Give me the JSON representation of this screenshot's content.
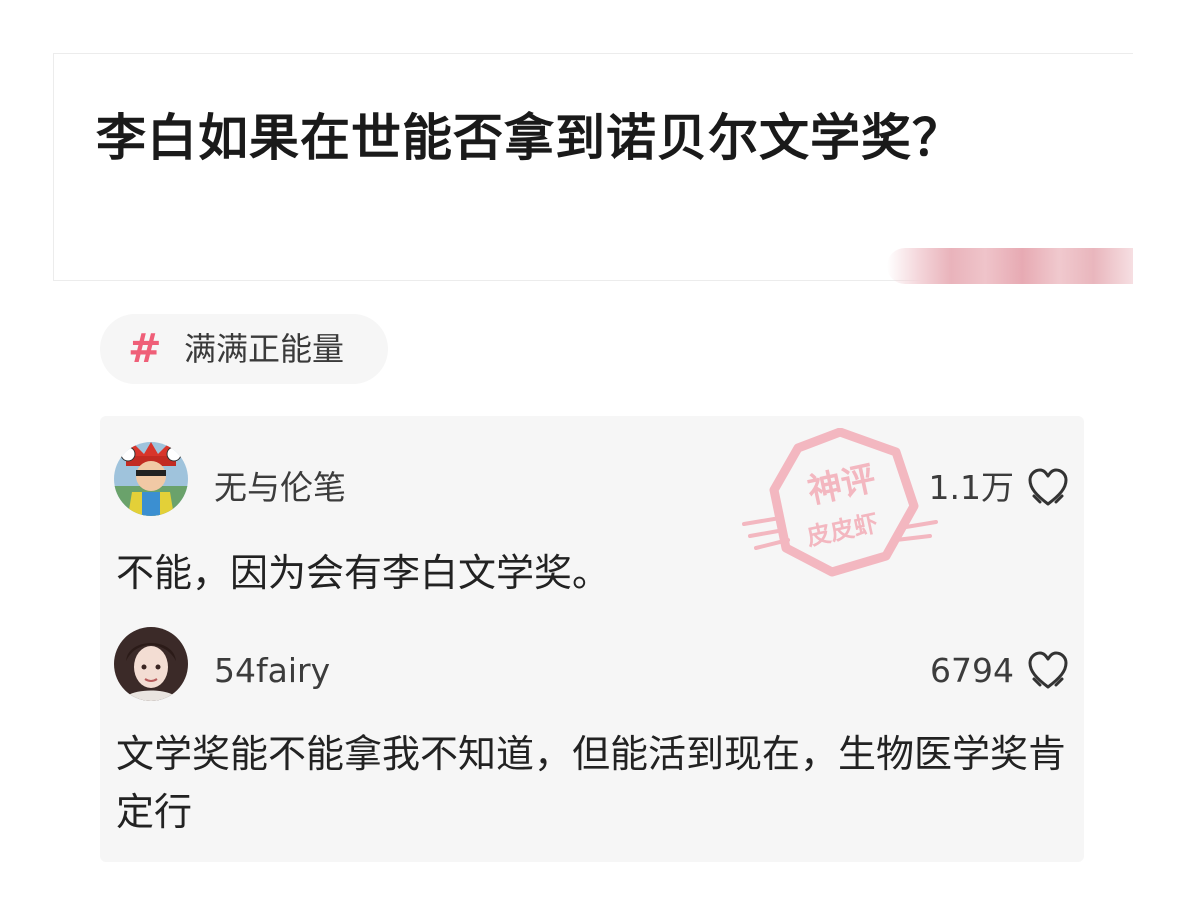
{
  "post": {
    "title": "李白如果在世能否拿到诺贝尔文学奖？"
  },
  "tag": {
    "icon": "hash-icon",
    "label": "满满正能量"
  },
  "comments": [
    {
      "user": "无与伦笔",
      "likes": "1.1万",
      "text": "不能，因为会有李白文学奖。",
      "avatar_icon": "cartoon-avatar"
    },
    {
      "user": "54fairy",
      "likes": "6794",
      "text": "文学奖能不能拿我不知道，但能活到现在，生物医学奖肯定行",
      "avatar_icon": "portrait-avatar"
    }
  ],
  "watermark": {
    "line1": "神评",
    "line2": "皮皮虾"
  },
  "colors": {
    "accent_pink": "#ef5f78",
    "comment_bg": "#f6f6f6",
    "watermark": "#f2a3ae"
  }
}
